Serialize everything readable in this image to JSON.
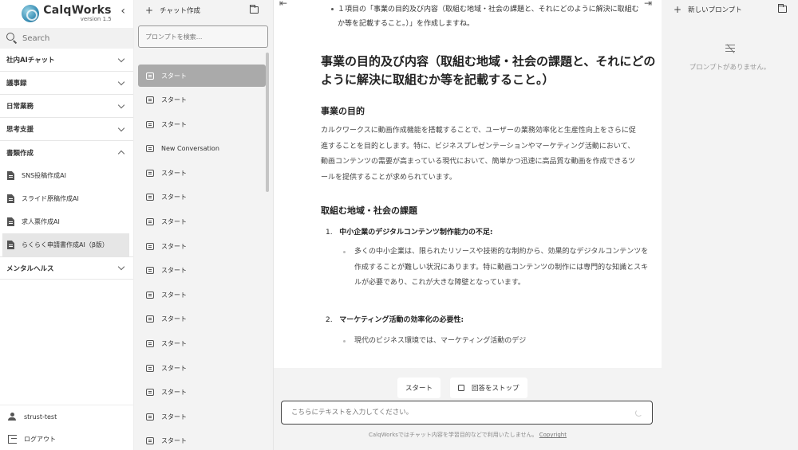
{
  "app": {
    "name": "CalqWorks",
    "version": "version 1.5"
  },
  "sidebar": {
    "collapse_glyph": "‹",
    "search_placeholder": "Search",
    "categories": [
      {
        "label": "社内AIチャット",
        "expanded": false
      },
      {
        "label": "議事録",
        "expanded": false
      },
      {
        "label": "日常業務",
        "expanded": false
      },
      {
        "label": "思考支援",
        "expanded": false
      },
      {
        "label": "書類作成",
        "expanded": true
      }
    ],
    "sub_items": [
      {
        "label": "SNS投稿作成AI"
      },
      {
        "label": "スライド原稿作成AI"
      },
      {
        "label": "求人票作成AI"
      },
      {
        "label": "らくらく申請書作成AI（β版）",
        "active": true
      }
    ],
    "last_category": {
      "label": "メンタルヘルス",
      "expanded": false
    },
    "user": {
      "name": "strust-test",
      "logout_label": "ログアウト"
    }
  },
  "conversations": {
    "new_chat_label": "チャット作成",
    "search_placeholder": "プロンプトを検索...",
    "items": [
      {
        "label": "スタート",
        "active": true
      },
      {
        "label": "スタート"
      },
      {
        "label": "スタート"
      },
      {
        "label": "New Conversation"
      },
      {
        "label": "スタート"
      },
      {
        "label": "スタート"
      },
      {
        "label": "スタート"
      },
      {
        "label": "スタート"
      },
      {
        "label": "スタート"
      },
      {
        "label": "スタート"
      },
      {
        "label": "スタート"
      },
      {
        "label": "スタート"
      },
      {
        "label": "スタート"
      },
      {
        "label": "スタート"
      },
      {
        "label": "スタート"
      },
      {
        "label": "スタート"
      }
    ]
  },
  "chat": {
    "prev_bullet": "１項目の「事業の目的及び内容（取組む地域・社会の課題と、それにどのように解決に取組むか等を記載すること。）」を作成しますね。",
    "heading": "事業の目的及び内容（取組む地域・社会の課題と、それにどのように解決に取組むか等を記載すること。）",
    "section1_title": "事業の目的",
    "section1_text": "カルクワークスに動画作成機能を搭載することで、ユーザーの業務効率化と生産性向上をさらに促進することを目的とします。特に、ビジネスプレゼンテーションやマーケティング活動において、動画コンテンツの需要が高まっている現代において、簡単かつ迅速に高品質な動画を作成できるツールを提供することが求められています。",
    "section2_title": "取組む地域・社会の課題",
    "item1_num": "1.",
    "item1_title": "中小企業のデジタルコンテンツ制作能力の不足:",
    "item1_text": "多くの中小企業は、限られたリソースや技術的な制約から、効果的なデジタルコンテンツを作成することが難しい状況にあります。特に動画コンテンツの制作には専門的な知識とスキルが必要であり、これが大きな障壁となっています。",
    "item2_num": "2.",
    "item2_title": "マーケティング活動の効率化の必要性:",
    "item2_text": "現代のビジネス環境では、マーケティング活動のデジ"
  },
  "composer": {
    "start_label": "スタート",
    "stop_label": "回答をストップ",
    "input_placeholder": "こちらにテキストを入力してください。",
    "footer_text": "CalqWorksではチャット内容を学習目的などで利用いたしません。",
    "footer_link": "Copyright"
  },
  "prompts_panel": {
    "new_prompt_label": "新しいプロンプト",
    "empty_text": "プロンプトがありません。"
  }
}
